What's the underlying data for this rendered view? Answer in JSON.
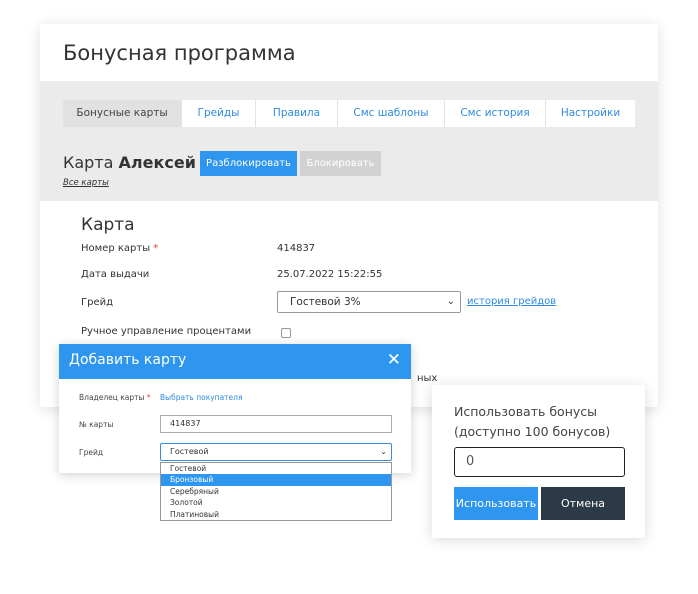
{
  "page": {
    "title": "Бонусная программа",
    "tabs": [
      {
        "label": "Бонусные карты"
      },
      {
        "label": "Грейды"
      },
      {
        "label": "Правила"
      },
      {
        "label": "Смс шаблоны"
      },
      {
        "label": "Смс история"
      },
      {
        "label": "Настройки"
      }
    ],
    "active_tab": "Бонусные карты"
  },
  "card_header": {
    "prefix": "Карта",
    "owner": "Алексей В.",
    "all_cards_link": "Все карты",
    "unblock_button": "Разблокировать",
    "block_button": "Блокировать"
  },
  "card_section": {
    "title": "Карта",
    "number_label": "Номер карты",
    "number_value": "414837",
    "issue_date_label": "Дата выдачи",
    "issue_date_value": "25.07.2022 15:22:55",
    "grade_label": "Грейд",
    "grade_value": "Гостевой 3%",
    "grade_history_link": "история грейдов",
    "manual_percent_label": "Ручное управление процентами",
    "manual_percent_checked": false,
    "partial_text": "ных"
  },
  "add_card_modal": {
    "title": "Добавить карту",
    "owner_label": "Владелец карты",
    "choose_buyer_link": "Выбрать покупателя",
    "card_number_label": "№ карты",
    "card_number_value": "414837",
    "grade_label": "Грейд",
    "grade_selected": "Гостевой",
    "grade_options": [
      "Гостевой",
      "Бронзовый",
      "Серебряный",
      "Золотой",
      "Платиновый"
    ],
    "highlighted_option": "Бронзовый"
  },
  "use_bonus": {
    "title": "Использовать бонусы (доступно 100 бонусов)",
    "amount_value": "0",
    "use_button": "Использовать",
    "cancel_button": "Отмена"
  },
  "colors": {
    "accent": "#2f96ef",
    "link": "#2f8be0",
    "dark_button": "#2b3a46",
    "required": "#e23b3b"
  },
  "icons": {
    "close": "close-icon",
    "select_arrow": "chevron-down-icon"
  }
}
